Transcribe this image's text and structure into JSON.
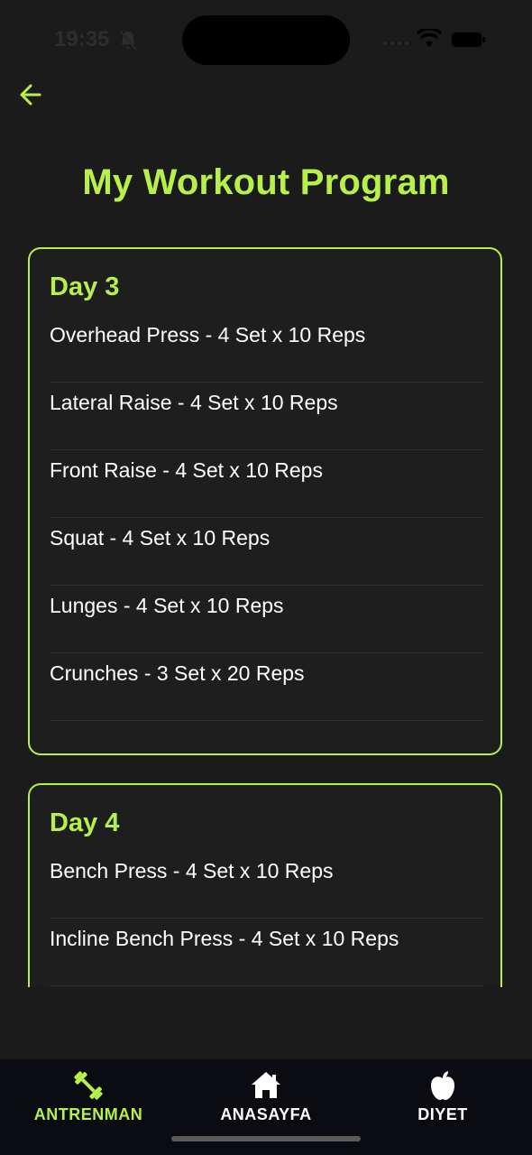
{
  "status": {
    "time": "19:35"
  },
  "header": {
    "title": "My Workout Program"
  },
  "days": [
    {
      "title": "Day 3",
      "exercises": [
        "Overhead Press - 4 Set x 10 Reps",
        "Lateral Raise - 4 Set x 10 Reps",
        "Front Raise - 4 Set x 10 Reps",
        "Squat - 4 Set x 10 Reps",
        "Lunges - 4 Set x 10 Reps",
        "Crunches - 3 Set x 20 Reps"
      ]
    },
    {
      "title": "Day 4",
      "exercises": [
        "Bench Press - 4 Set x 10 Reps",
        "Incline Bench Press - 4 Set x 10 Reps"
      ]
    }
  ],
  "tabs": [
    {
      "label": "ANTRENMAN",
      "icon": "dumbbell-icon",
      "active": true
    },
    {
      "label": "ANASAYFA",
      "icon": "home-icon",
      "active": false
    },
    {
      "label": "DIYET",
      "icon": "apple-icon",
      "active": false
    }
  ],
  "colors": {
    "accent": "#b7f04a",
    "background": "#1b1b1b",
    "card": "#1e1e1e",
    "tabbar": "#0b0b12"
  }
}
